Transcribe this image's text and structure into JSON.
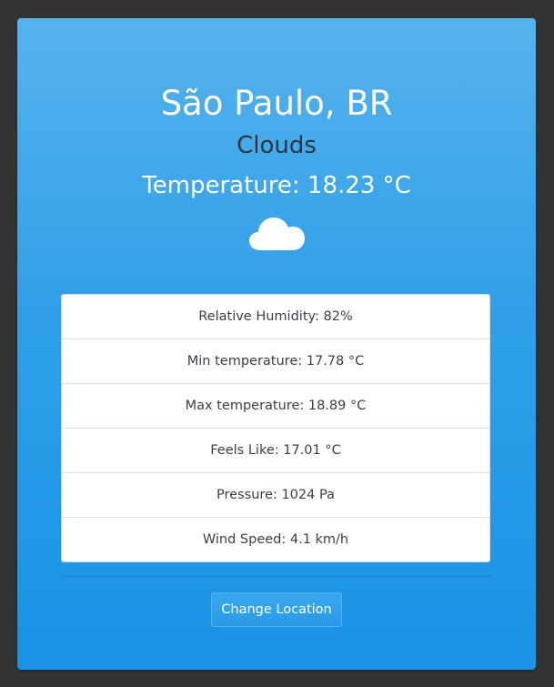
{
  "weather": {
    "city": "São Paulo, BR",
    "condition": "Clouds",
    "temperature": "Temperature: 18.23 °C",
    "icon": "cloud-icon"
  },
  "details": [
    {
      "label": "Relative Humidity: 82%"
    },
    {
      "label": "Min temperature: 17.78 °C"
    },
    {
      "label": "Max temperature: 18.89 °C"
    },
    {
      "label": "Feels Like: 17.01 °C"
    },
    {
      "label": "Pressure: 1024 Pa"
    },
    {
      "label": "Wind Speed: 4.1 km/h"
    }
  ],
  "actions": {
    "change_location_label": "Change Location"
  },
  "colors": {
    "page_background": "#333333",
    "card_gradient_top": "#55b3ec",
    "card_gradient_bottom": "#1a93e6",
    "condition_text": "#2e3440"
  }
}
